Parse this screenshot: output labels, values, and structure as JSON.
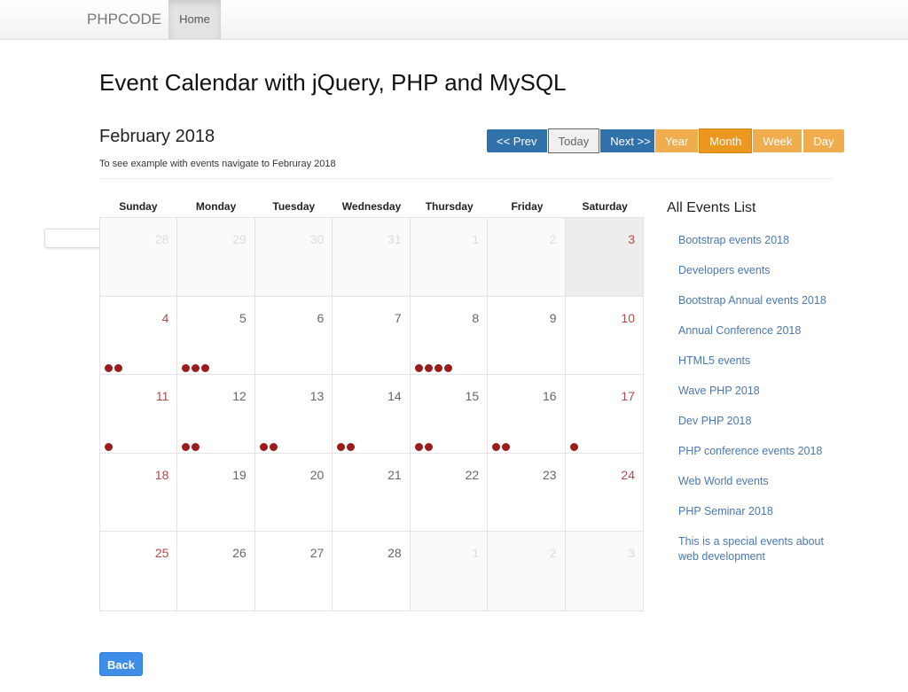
{
  "navbar": {
    "brand": "PHPCODE",
    "home": "Home"
  },
  "page_title": "Event Calendar with jQuery, PHP and MySQL",
  "calendar": {
    "month_title": "February 2018",
    "hint": "To see example with events navigate to Februray 2018",
    "nav_buttons": {
      "prev": "<< Prev",
      "today": "Today",
      "next": "Next >>"
    },
    "view_buttons": {
      "year": "Year",
      "month": "Month",
      "week": "Week",
      "day": "Day",
      "active": "Month"
    },
    "weekdays": [
      "Sunday",
      "Monday",
      "Tuesday",
      "Wednesday",
      "Thursday",
      "Friday",
      "Saturday"
    ],
    "weeks": [
      [
        {
          "day": "28",
          "outside": true,
          "dots": 0
        },
        {
          "day": "29",
          "outside": true,
          "dots": 0
        },
        {
          "day": "30",
          "outside": true,
          "dots": 0
        },
        {
          "day": "31",
          "outside": true,
          "dots": 0
        },
        {
          "day": "1",
          "outside": true,
          "dots": 0
        },
        {
          "day": "2",
          "outside": true,
          "dots": 0
        },
        {
          "day": "3",
          "outside": true,
          "today": true,
          "dots": 0
        }
      ],
      [
        {
          "day": "4",
          "dots": 2
        },
        {
          "day": "5",
          "dots": 3
        },
        {
          "day": "6",
          "dots": 0
        },
        {
          "day": "7",
          "dots": 0
        },
        {
          "day": "8",
          "dots": 4
        },
        {
          "day": "9",
          "dots": 0
        },
        {
          "day": "10",
          "dots": 0
        }
      ],
      [
        {
          "day": "11",
          "dots": 1
        },
        {
          "day": "12",
          "dots": 2
        },
        {
          "day": "13",
          "dots": 2
        },
        {
          "day": "14",
          "dots": 2
        },
        {
          "day": "15",
          "dots": 2
        },
        {
          "day": "16",
          "dots": 2
        },
        {
          "day": "17",
          "dots": 1
        }
      ],
      [
        {
          "day": "18",
          "dots": 0
        },
        {
          "day": "19",
          "dots": 0
        },
        {
          "day": "20",
          "dots": 0
        },
        {
          "day": "21",
          "dots": 0
        },
        {
          "day": "22",
          "dots": 0
        },
        {
          "day": "23",
          "dots": 0
        },
        {
          "day": "24",
          "dots": 0
        }
      ],
      [
        {
          "day": "25",
          "dots": 0
        },
        {
          "day": "26",
          "dots": 0
        },
        {
          "day": "27",
          "dots": 0
        },
        {
          "day": "28",
          "dots": 0
        },
        {
          "day": "1",
          "outside": true,
          "dots": 0
        },
        {
          "day": "2",
          "outside": true,
          "dots": 0
        },
        {
          "day": "3",
          "outside": true,
          "dots": 0
        }
      ]
    ]
  },
  "events": {
    "title": "All Events List",
    "items": [
      "Bootstrap events 2018",
      "Developers events",
      "Bootstrap Annual events 2018",
      "Annual Conference 2018",
      "HTML5 events",
      "Wave PHP 2018",
      "Dev PHP 2018",
      "PHP conference events 2018",
      "Web World events",
      "PHP Seminar 2018",
      "This is a special events about web development"
    ]
  },
  "back_button": "Back",
  "colors": {
    "weekend": "#b14a4a",
    "event_dot": "#9c1b1b",
    "primary": "#3071a9",
    "warning": "#f0ad4e",
    "link": "#4a78b0"
  }
}
